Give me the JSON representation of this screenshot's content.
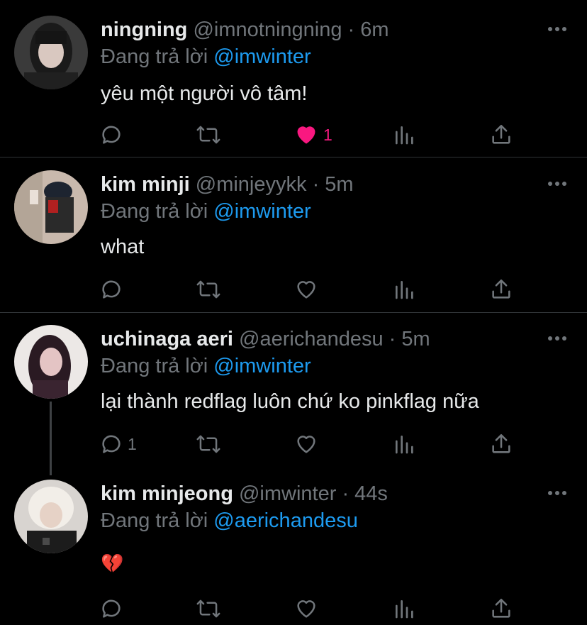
{
  "tweets": [
    {
      "name": "ningning",
      "handle": "@imnotningning",
      "time": "6m",
      "reply_prefix": "Đang trả lời",
      "reply_to": "@imwinter",
      "text": "yêu một người vô tâm!",
      "reply_count": "",
      "like_count": "1",
      "liked": true
    },
    {
      "name": "kim minji",
      "handle": "@minjeyykk",
      "time": "5m",
      "reply_prefix": "Đang trả lời",
      "reply_to": "@imwinter",
      "text": "what",
      "reply_count": "",
      "like_count": "",
      "liked": false
    },
    {
      "name": "uchinaga aeri",
      "handle": "@aerichandesu",
      "time": "5m",
      "reply_prefix": "Đang trả lời",
      "reply_to": "@imwinter",
      "text": "lại thành redflag luôn chứ ko pinkflag nữa",
      "reply_count": "1",
      "like_count": "",
      "liked": false
    },
    {
      "name": "kim minjeong",
      "handle": "@imwinter",
      "time": "44s",
      "reply_prefix": "Đang trả lời",
      "reply_to": "@aerichandesu",
      "text": "💔",
      "reply_count": "",
      "like_count": "",
      "liked": false
    }
  ],
  "colors": {
    "background": "#000000",
    "text": "#e7e9ea",
    "muted": "#71767b",
    "mention": "#1d9bf0",
    "like": "#f91880",
    "divider": "#2f3336"
  },
  "icons": [
    "reply-icon",
    "retweet-icon",
    "like-icon",
    "views-icon",
    "share-icon",
    "more-icon",
    "broken-heart-emoji"
  ]
}
